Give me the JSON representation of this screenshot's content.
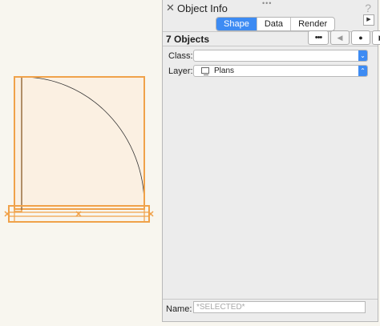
{
  "panel": {
    "title": "Object Info",
    "help_glyph": "?",
    "close_glyph": "✕",
    "grip_glyph": "•••",
    "collapse_glyph": "▶",
    "tabs": [
      {
        "label": "Shape",
        "active": true
      },
      {
        "label": "Data",
        "active": false
      },
      {
        "label": "Render",
        "active": false
      }
    ],
    "object_count": "7 Objects",
    "buttons": {
      "more": "•••",
      "prev": "◀",
      "record": "●",
      "next": "▶"
    },
    "fields": {
      "class_label": "Class:",
      "class_value": "",
      "layer_label": "Layer:",
      "layer_value": "Plans",
      "dropdown_arrow": "⌃⌄"
    },
    "name_label": "Name:",
    "name_placeholder": "*SELECTED*",
    "name_value": ""
  },
  "colors": {
    "accent": "#3d8bf3",
    "selection": "#f0a24a",
    "door_fill": "#fbf0e2",
    "canvas_bg": "#f8f6ef"
  }
}
